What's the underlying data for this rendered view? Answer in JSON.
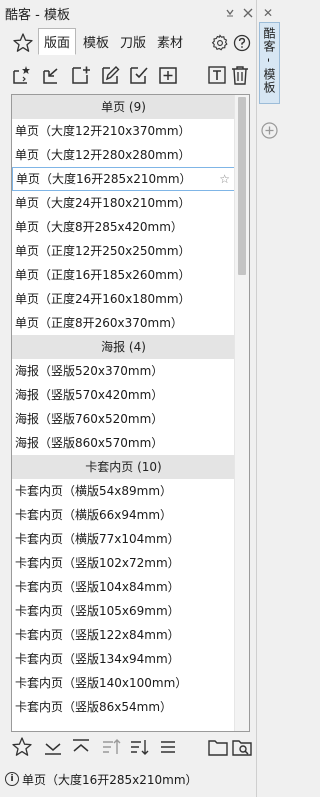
{
  "window": {
    "title": "酷客 - 模板"
  },
  "tabs": [
    {
      "label": "版面",
      "active": true
    },
    {
      "label": "模板",
      "active": false
    },
    {
      "label": "刀版",
      "active": false
    },
    {
      "label": "素材",
      "active": false
    }
  ],
  "groups": [
    {
      "header": "单页 (9)",
      "items": [
        "单页（大度12开210x370mm）",
        "单页（大度12开280x280mm）",
        "单页（大度16开285x210mm）",
        "单页（大度24开180x210mm）",
        "单页（大度8开285x420mm）",
        "单页（正度12开250x250mm）",
        "单页（正度16开185x260mm）",
        "单页（正度24开160x180mm）",
        "单页（正度8开260x370mm）"
      ]
    },
    {
      "header": "海报 (4)",
      "items": [
        "海报（竖版520x370mm）",
        "海报（竖版570x420mm）",
        "海报（竖版760x520mm）",
        "海报（竖版860x570mm）"
      ]
    },
    {
      "header": "卡套内页 (10)",
      "items": [
        "卡套内页（横版54x89mm）",
        "卡套内页（横版66x94mm）",
        "卡套内页（横版77x104mm）",
        "卡套内页（竖版102x72mm）",
        "卡套内页（竖版104x84mm）",
        "卡套内页（竖版105x69mm）",
        "卡套内页（竖版122x84mm）",
        "卡套内页（竖版134x94mm）",
        "卡套内页（竖版140x100mm）",
        "卡套内页（竖版86x54mm）"
      ]
    }
  ],
  "selected_item": "单页（大度16开285x210mm）",
  "status": {
    "text": "单页（大度16开285x210mm）"
  },
  "docker": {
    "tab_label": "酷客 - 模板"
  },
  "colors": {
    "selection_border": "#7fb5e6",
    "group_bg": "#e4e4e4",
    "docker_tab_bg": "#d7e6f3",
    "accent_red": "#d03030"
  },
  "icons": {
    "toolbar": [
      "new-template-icon",
      "import-icon",
      "add-page-icon",
      "edit-icon",
      "confirm-icon",
      "add-icon",
      "text-icon",
      "delete-icon"
    ],
    "bottom": [
      "favorite-icon",
      "move-bottom-icon",
      "move-top-icon",
      "sort-asc-icon",
      "sort-desc-icon",
      "list-view-icon",
      "folder-icon",
      "search-folder-icon"
    ]
  }
}
